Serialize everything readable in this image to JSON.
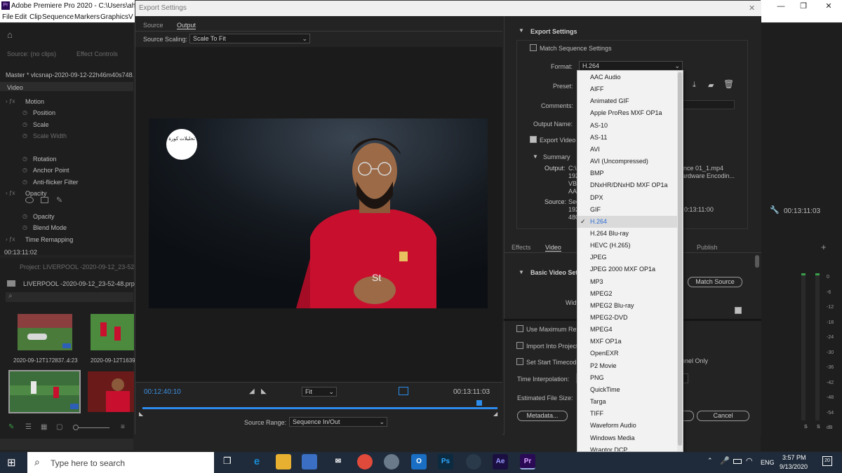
{
  "window": {
    "app_title": "Adobe Premiere Pro 2020 - C:\\Users\\ahelb",
    "controls": [
      "—",
      "❐",
      "✕"
    ]
  },
  "menubar": [
    "File",
    "Edit",
    "Clip",
    "Sequence",
    "Markers",
    "Graphics",
    "V"
  ],
  "left_panel": {
    "source_label": "Source: (no clips)",
    "effect_controls_tab": "Effect Controls",
    "master_clip": "Master * vlcsnap-2020-09-12-22h46m40s748.pn",
    "video_header": "Video",
    "effects": [
      {
        "label": "Motion",
        "fx": true
      },
      {
        "label": "Position"
      },
      {
        "label": "Scale"
      },
      {
        "label": "Scale Width"
      },
      {
        "label": "Rotation"
      },
      {
        "label": "Anchor Point"
      },
      {
        "label": "Anti-flicker Filter"
      },
      {
        "label": "Opacity",
        "fx": true
      },
      {
        "label": "Opacity"
      },
      {
        "label": "Blend Mode"
      },
      {
        "label": "Time Remapping",
        "fx": true
      }
    ],
    "timecode": "00:13:11:02",
    "project_tab": "Project: LIVERPOOL -2020-09-12_23-52-48",
    "project_file": "LIVERPOOL -2020-09-12_23-52-48.prproj",
    "thumbnails": [
      {
        "name": "2020-09-12T172837...",
        "duration": "4:23"
      },
      {
        "name": "2020-09-12T163941",
        "duration": ""
      }
    ]
  },
  "dialog": {
    "title": "Export Settings",
    "tabs": [
      "Source",
      "Output"
    ],
    "source_scaling_label": "Source Scaling:",
    "source_scaling_value": "Scale To Fit",
    "logo_text": "تحليلات كورة",
    "timecode_in": "00:12:40:10",
    "timecode_out": "00:13:11:03",
    "fit_value": "Fit",
    "source_range_label": "Source Range:",
    "source_range_value": "Sequence In/Out",
    "export_settings": {
      "section_title": "Export Settings",
      "match_sequence": "Match Sequence Settings",
      "format_label": "Format:",
      "format_value": "H.264",
      "preset_label": "Preset:",
      "comments_label": "Comments:",
      "output_name_label": "Output Name:",
      "export_video": "Export Video",
      "summary_title": "Summary",
      "output_label": "Output:",
      "output_lines": [
        "C:\\U",
        "192",
        "VBR",
        "AAC"
      ],
      "output_tail": [
        "nce 01_1.mp4",
        "ardware Encodin..."
      ],
      "source_label": "Source:",
      "source_lines": [
        "Seq",
        "192",
        "480"
      ],
      "source_tail": "0:13:11:00"
    },
    "lower_tabs": [
      "Effects",
      "Video",
      "Publish"
    ],
    "basic_video": "Basic Video Setti",
    "match_source_button": "Match Source",
    "width_label": "Widt",
    "options": [
      "Use Maximum Rend",
      "Import Into Project",
      "Set Start Timecode"
    ],
    "channel_only": "nnel Only",
    "time_interpolation": "Time Interpolation:",
    "estimated_size": "Estimated File Size:",
    "metadata_button": "Metadata...",
    "cancel_button": "Cancel"
  },
  "format_menu": {
    "items": [
      "AAC Audio",
      "AIFF",
      "Animated GIF",
      "Apple ProRes MXF OP1a",
      "AS-10",
      "AS-11",
      "AVI",
      "AVI (Uncompressed)",
      "BMP",
      "DNxHR/DNxHD MXF OP1a",
      "DPX",
      "GIF",
      "H.264",
      "H.264 Blu-ray",
      "HEVC (H.265)",
      "JPEG",
      "JPEG 2000 MXF OP1a",
      "MP3",
      "MPEG2",
      "MPEG2 Blu-ray",
      "MPEG2-DVD",
      "MPEG4",
      "MXF OP1a",
      "OpenEXR",
      "P2 Movie",
      "PNG",
      "QuickTime",
      "Targa",
      "TIFF",
      "Waveform Audio",
      "Windows Media",
      "Wraptor DCP"
    ],
    "selected": "H.264",
    "check_glyph": "✓"
  },
  "right_panel": {
    "timecode": "00:13:11:03",
    "meter_ticks": [
      "0",
      "-6",
      "-12",
      "-18",
      "-24",
      "-30",
      "-36",
      "-42",
      "-48",
      "-54",
      "dB"
    ],
    "solo": [
      "S",
      "S"
    ]
  },
  "taskbar": {
    "search_placeholder": "Type here to search",
    "apps": [
      "Ps",
      "Ae",
      "Pr"
    ],
    "lang": "ENG",
    "time": "3:57 PM",
    "date": "9/13/2020",
    "notifications": "20"
  },
  "colors": {
    "accent_blue": "#2d8ceb",
    "timecode_blue": "#3d8fe0",
    "jersey_red": "#c8102e"
  }
}
